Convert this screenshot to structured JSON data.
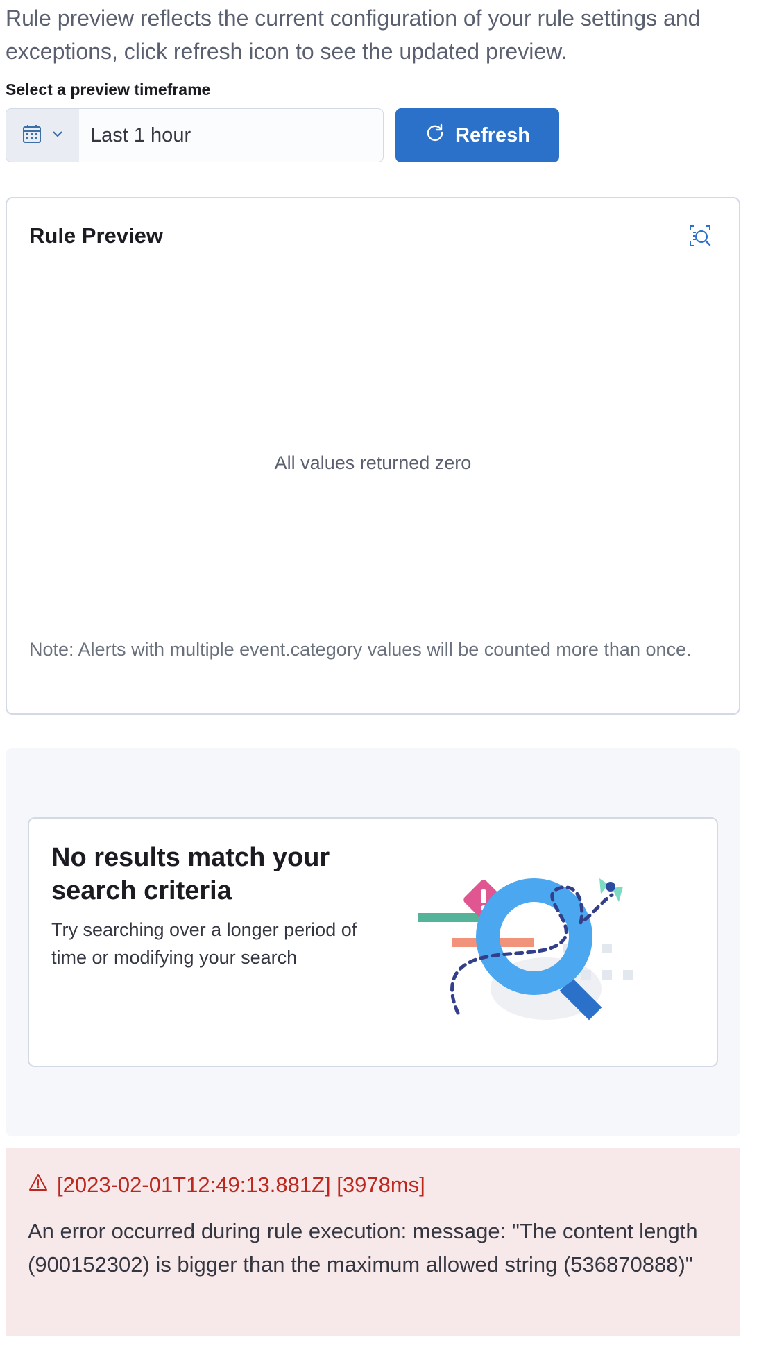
{
  "intro": {
    "text": "Rule preview reflects the current configuration of your rule settings and exceptions, click refresh icon to see the updated preview."
  },
  "timeframe": {
    "label": "Select a preview timeframe",
    "quick_menu_icon": "calendar-icon",
    "value": "Last 1 hour"
  },
  "refresh_button": {
    "label": "Refresh",
    "icon": "refresh-icon",
    "color": "#2b70c9"
  },
  "rule_preview": {
    "title": "Rule Preview",
    "inspect_icon": "inspect-icon",
    "empty_message": "All values returned zero",
    "note": "Note: Alerts with multiple event.category values will be counted more than once."
  },
  "no_results": {
    "title": "No results match your search criteria",
    "body": "Try searching over a longer period of time or modifying your search",
    "illustration": "magnifying-glass-illustration"
  },
  "error": {
    "icon": "warning-icon",
    "title": "[2023-02-01T12:49:13.881Z] [3978ms]",
    "message": "An error occurred during rule execution: message: \"The content length (900152302) is bigger than the maximum allowed string (536870888)\"",
    "color": "#bd271e",
    "background": "#f7e8e9"
  }
}
